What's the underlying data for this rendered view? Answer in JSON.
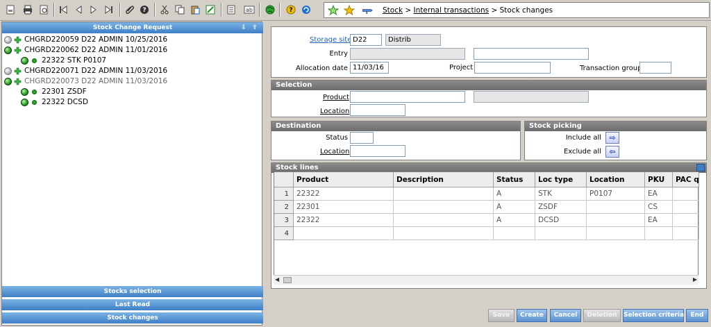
{
  "toolbar": {
    "icons": [
      "new-icon",
      "print-icon",
      "print-preview-icon",
      "first-record-icon",
      "previous-record-icon",
      "next-record-icon",
      "last-record-icon",
      "attachment-icon",
      "help-icon",
      "cut-icon",
      "copy-icon",
      "paste-icon",
      "edit-icon",
      "properties-icon",
      "text-icon",
      "globe-icon",
      "info-icon",
      "refresh-icon",
      "favorite-add-icon",
      "favorite-icon",
      "pin-icon"
    ]
  },
  "breadcrumb": {
    "part1": "Stock",
    "sep1": " > ",
    "part2": "Internal transactions",
    "sep2": " > ",
    "part3": "Stock changes"
  },
  "left": {
    "title": "Stock Change Request",
    "tree": [
      {
        "label": "CHGRD220059 D22 ADMIN 10/25/2016",
        "status": "gray",
        "style": "normal"
      },
      {
        "label": "CHGRD220062 D22 ADMIN 11/01/2016",
        "status": "green",
        "style": "normal"
      },
      {
        "label": "22322 STK P0107",
        "status": "green",
        "style": "child"
      },
      {
        "label": "CHGRD220071 D22 ADMIN 11/03/2016",
        "status": "gray",
        "style": "normal"
      },
      {
        "label": "CHGRD220073 D22 ADMIN 11/03/2016",
        "status": "green",
        "style": "gray"
      },
      {
        "label": "22301 ZSDF",
        "status": "green",
        "style": "child"
      },
      {
        "label": "22322 DCSD",
        "status": "green",
        "style": "child"
      }
    ],
    "sections": [
      "Stocks selection",
      "Last Read",
      "Stock changes"
    ]
  },
  "header": {
    "storage_site_label": "Storage site",
    "storage_site_value": "D22",
    "storage_site_name": "Distrib",
    "entry_label": "Entry",
    "entry_value": "",
    "entry_desc": "",
    "allocation_date_label": "Allocation date",
    "allocation_date_value": "11/03/16",
    "project_label": "Project",
    "project_value": "",
    "transaction_group_label": "Transaction group",
    "transaction_group_value": ""
  },
  "selection": {
    "title": "Selection",
    "product_label": "Product",
    "product_value": "",
    "product_desc": "",
    "location_label": "Location",
    "location_value": ""
  },
  "destination": {
    "title": "Destination",
    "status_label": "Status",
    "status_value": "",
    "location_label": "Location",
    "location_value": ""
  },
  "picking": {
    "title": "Stock picking",
    "include_all_label": "Include all",
    "exclude_all_label": "Exclude all"
  },
  "stock_lines": {
    "title": "Stock lines",
    "columns": [
      "Product",
      "Description",
      "Status",
      "Loc type",
      "Location",
      "PKU",
      "PAC qu"
    ],
    "rows": [
      {
        "num": "1",
        "product": "22322",
        "description": "",
        "status": "A",
        "loc_type": "STK",
        "location": "P0107",
        "pku": "EA",
        "pac": ""
      },
      {
        "num": "2",
        "product": "22301",
        "description": "",
        "status": "A",
        "loc_type": "ZSDF",
        "location": "",
        "pku": "CS",
        "pac": ""
      },
      {
        "num": "3",
        "product": "22322",
        "description": "",
        "status": "A",
        "loc_type": "DCSD",
        "location": "",
        "pku": "EA",
        "pac": ""
      },
      {
        "num": "4",
        "product": "",
        "description": "",
        "status": "",
        "loc_type": "",
        "location": "",
        "pku": "",
        "pac": ""
      }
    ]
  },
  "footer": {
    "save": "Save",
    "create": "Create",
    "cancel": "Cancel",
    "deletion": "Deletion",
    "selection_criteria": "Selection criteria",
    "end": "End"
  },
  "colors": {
    "accent": "#3e7fc6",
    "panel_header": "#7a7a7a",
    "status_green": "#2fa32f"
  }
}
